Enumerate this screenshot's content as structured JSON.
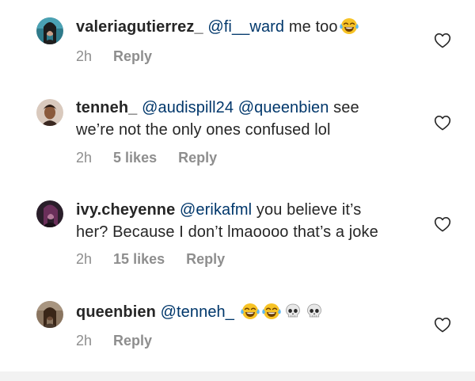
{
  "comments": [
    {
      "username": "valeriagutierrez_",
      "mentions": [
        "@fi__ward"
      ],
      "text_after_mention": " me too",
      "emojis": [
        "face-with-tears-of-joy"
      ],
      "time": "2h",
      "likes": "",
      "reply_label": "Reply"
    },
    {
      "username": "tenneh_",
      "mentions": [
        "@audispill24",
        "@queenbien"
      ],
      "text_line1_after": " see",
      "text_line2": "we’re not the only ones confused lol",
      "time": "2h",
      "likes": "5 likes",
      "reply_label": "Reply"
    },
    {
      "username": "ivy.cheyenne",
      "mentions": [
        "@erikafml"
      ],
      "text_line1_after": " you believe it’s",
      "text_line2": "her? Because I don’t lmaoooo that’s a joke",
      "time": "2h",
      "likes": "15 likes",
      "reply_label": "Reply"
    },
    {
      "username": "queenbien",
      "mentions": [
        "@tenneh_"
      ],
      "emojis": [
        "face-with-tears-of-joy",
        "face-with-tears-of-joy",
        "skull",
        "skull"
      ],
      "time": "2h",
      "likes": "",
      "reply_label": "Reply"
    }
  ],
  "icons": {
    "like": "heart-outline-icon",
    "laugh": "face-with-tears-of-joy",
    "skull": "skull"
  },
  "colors": {
    "text": "#262626",
    "mention": "#00376b",
    "meta": "#8e8e8e"
  }
}
